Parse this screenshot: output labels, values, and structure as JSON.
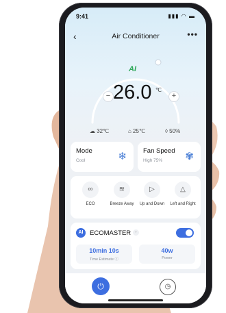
{
  "status": {
    "time": "9:41",
    "indicators": "▮▮▮ ◠ ▬"
  },
  "nav": {
    "back": "‹",
    "title": "Air Conditioner",
    "more": "•••"
  },
  "dial": {
    "logo": "AI",
    "temperature": "26.0",
    "unit": "℃",
    "minus": "−",
    "plus": "+"
  },
  "readings": [
    {
      "icon": "cloud-icon",
      "text": "☁ 32℃"
    },
    {
      "icon": "home-temp-icon",
      "text": "⌂ 25℃"
    },
    {
      "icon": "humidity-icon",
      "text": "◊ 50%"
    }
  ],
  "mode": {
    "title": "Mode",
    "value": "Cool",
    "icon": "❄"
  },
  "fan": {
    "title": "Fan Speed",
    "value": "High 75%",
    "icon": "✾"
  },
  "swing": [
    {
      "label": "ECO",
      "icon": "∞"
    },
    {
      "label": "Breeze Away",
      "icon": "≋"
    },
    {
      "label": "Up and Down",
      "icon": "▷"
    },
    {
      "label": "Left and Right",
      "icon": "△"
    }
  ],
  "eco": {
    "logo": "AI",
    "title": "ECOMASTER",
    "info": "›",
    "time_estimate": {
      "value": "10min 10s",
      "label": "Time Estimate ⓘ"
    },
    "power": {
      "value": "40w",
      "label": "Power"
    }
  },
  "bottom": {
    "power_icon": "⏻",
    "timer_icon": "◷"
  },
  "colors": {
    "accent": "#3d6ee0",
    "ai_green": "#2ea85a",
    "dial_gradient_start": "#d7ecf8"
  }
}
